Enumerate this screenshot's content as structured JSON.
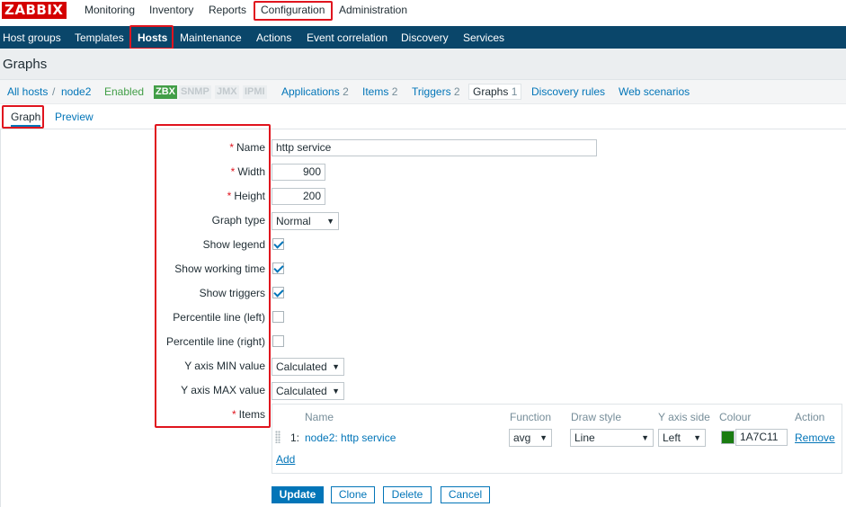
{
  "app": {
    "logo": "ZABBIX"
  },
  "top_menu": {
    "monitoring": "Monitoring",
    "inventory": "Inventory",
    "reports": "Reports",
    "configuration": "Configuration",
    "administration": "Administration"
  },
  "sub_menu": {
    "host_groups": "Host groups",
    "templates": "Templates",
    "hosts": "Hosts",
    "maintenance": "Maintenance",
    "actions": "Actions",
    "event_correlation": "Event correlation",
    "discovery": "Discovery",
    "services": "Services"
  },
  "page_title": "Graphs",
  "host_bar": {
    "all_hosts": "All hosts",
    "separator": "/",
    "host": "node2",
    "status": "Enabled",
    "badges": {
      "zbx": "ZBX",
      "snmp": "SNMP",
      "jmx": "JMX",
      "ipmi": "IPMI"
    },
    "applications": "Applications",
    "applications_count": "2",
    "items": "Items",
    "items_count": "2",
    "triggers": "Triggers",
    "triggers_count": "2",
    "graphs": "Graphs",
    "graphs_count": "1",
    "discovery_rules": "Discovery rules",
    "web_scenarios": "Web scenarios"
  },
  "form_tabs": {
    "graph": "Graph",
    "preview": "Preview"
  },
  "form": {
    "required_mark": "*",
    "name_label": "Name",
    "name_value": "http service",
    "width_label": "Width",
    "width_value": "900",
    "height_label": "Height",
    "height_value": "200",
    "graph_type_label": "Graph type",
    "graph_type_value": "Normal",
    "show_legend_label": "Show legend",
    "show_working_time_label": "Show working time",
    "show_triggers_label": "Show triggers",
    "percentile_left_label": "Percentile line (left)",
    "percentile_right_label": "Percentile line (right)",
    "y_min_label": "Y axis MIN value",
    "y_min_value": "Calculated",
    "y_max_label": "Y axis MAX value",
    "y_max_value": "Calculated",
    "items_label": "Items",
    "checkboxes": {
      "show_legend": true,
      "show_working_time": true,
      "show_triggers": true,
      "percentile_left": false,
      "percentile_right": false
    }
  },
  "items_table": {
    "headers": {
      "name": "Name",
      "function": "Function",
      "draw_style": "Draw style",
      "y_axis_side": "Y axis side",
      "colour": "Colour",
      "action": "Action"
    },
    "rows": [
      {
        "index": "1:",
        "name": "node2: http service",
        "function": "avg",
        "draw_style": "Line",
        "y_axis_side": "Left",
        "colour": "1A7C11",
        "colour_hex": "#1a7c11",
        "action": "Remove"
      }
    ],
    "add": "Add"
  },
  "buttons": {
    "update": "Update",
    "clone": "Clone",
    "delete": "Delete",
    "cancel": "Cancel"
  },
  "colors": {
    "brand": "#d40000",
    "nav": "#0a466a",
    "link": "#0275b8",
    "enabled": "#429e47",
    "highlight_box": "#e0141e"
  }
}
